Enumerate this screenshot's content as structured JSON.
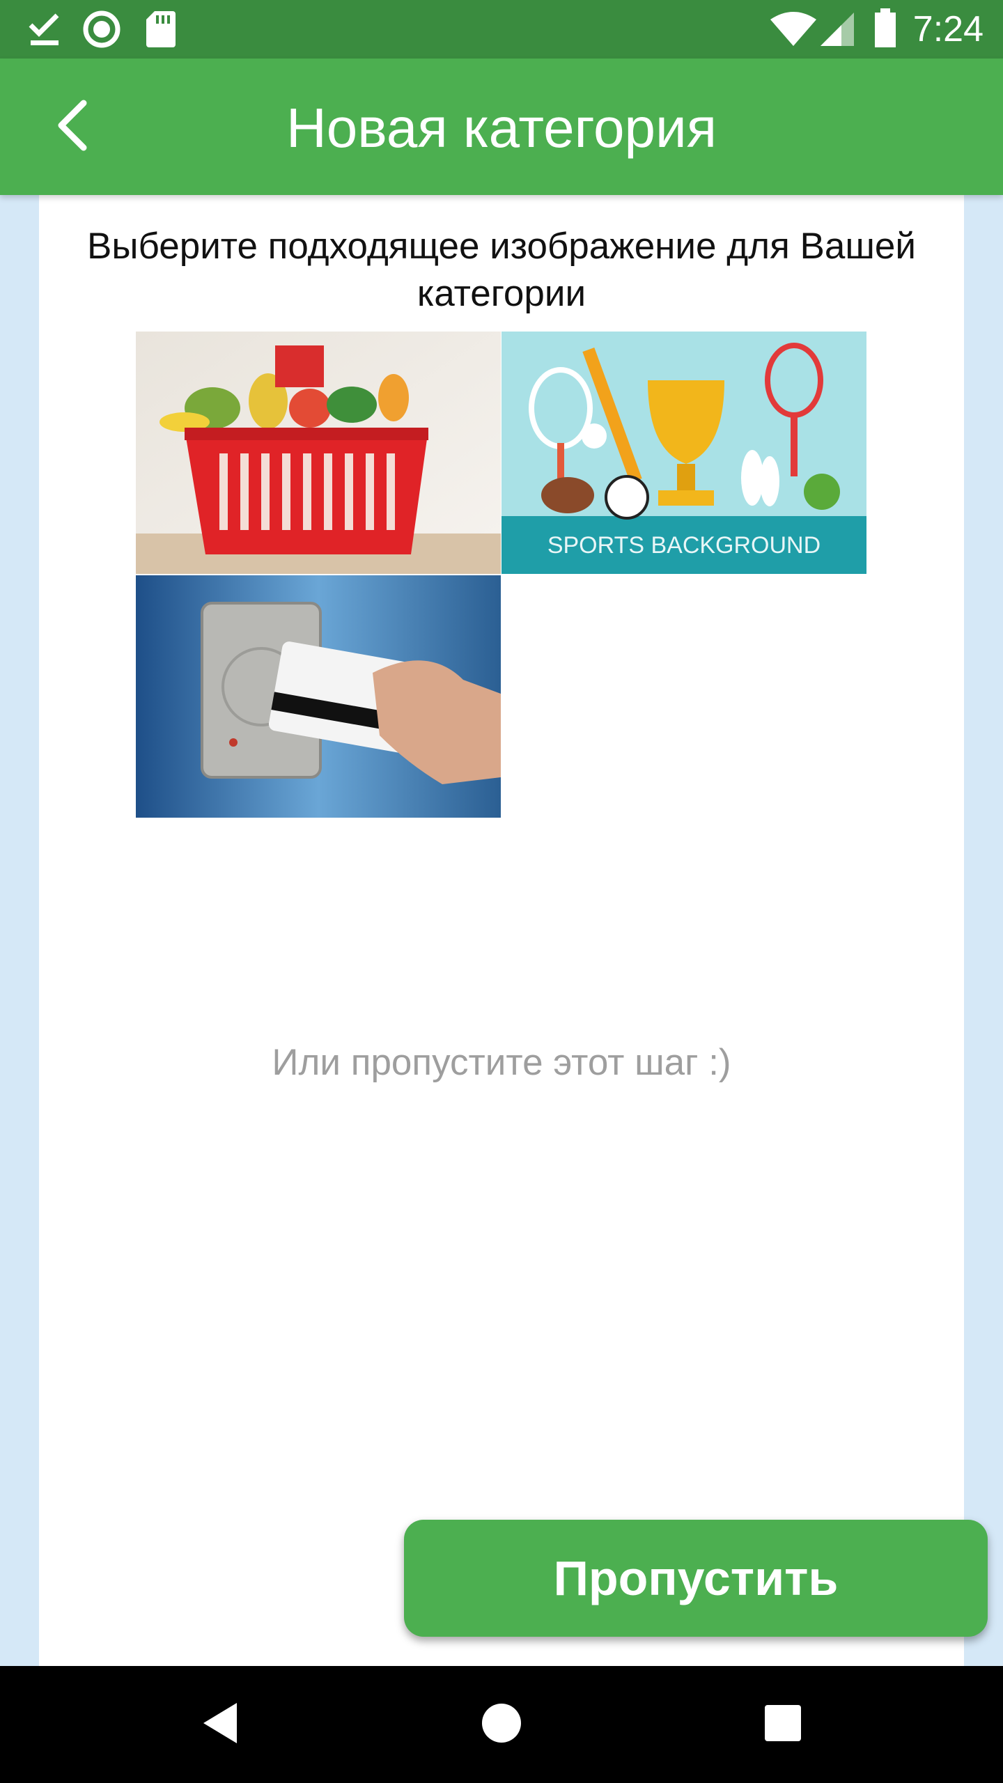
{
  "status_bar": {
    "time": "7:24",
    "icons": [
      "download-done-icon",
      "circle-icon",
      "sd-card-icon",
      "wifi-icon",
      "signal-icon",
      "battery-icon"
    ]
  },
  "app_bar": {
    "title": "Новая категория",
    "back_icon": "chevron-left-icon",
    "color": "#4caf50"
  },
  "main": {
    "instruction": "Выберите подходящее изображение для Вашей категории",
    "images": [
      {
        "name": "grocery-basket-image",
        "description_icon": "shopping-basket"
      },
      {
        "name": "sports-background-image",
        "caption": "SPORTS BACKGROUND"
      },
      {
        "name": "card-reader-image",
        "description_icon": "credit-card"
      }
    ],
    "skip_hint": "Или пропустите этот шаг :)",
    "skip_button_label": "Пропустить"
  },
  "nav_bar": {
    "buttons": [
      "back-triangle-icon",
      "home-circle-icon",
      "recents-square-icon"
    ]
  },
  "colors": {
    "accent": "#4caf50",
    "status_bar": "#3a8c3f",
    "background": "#d5e8f7"
  }
}
